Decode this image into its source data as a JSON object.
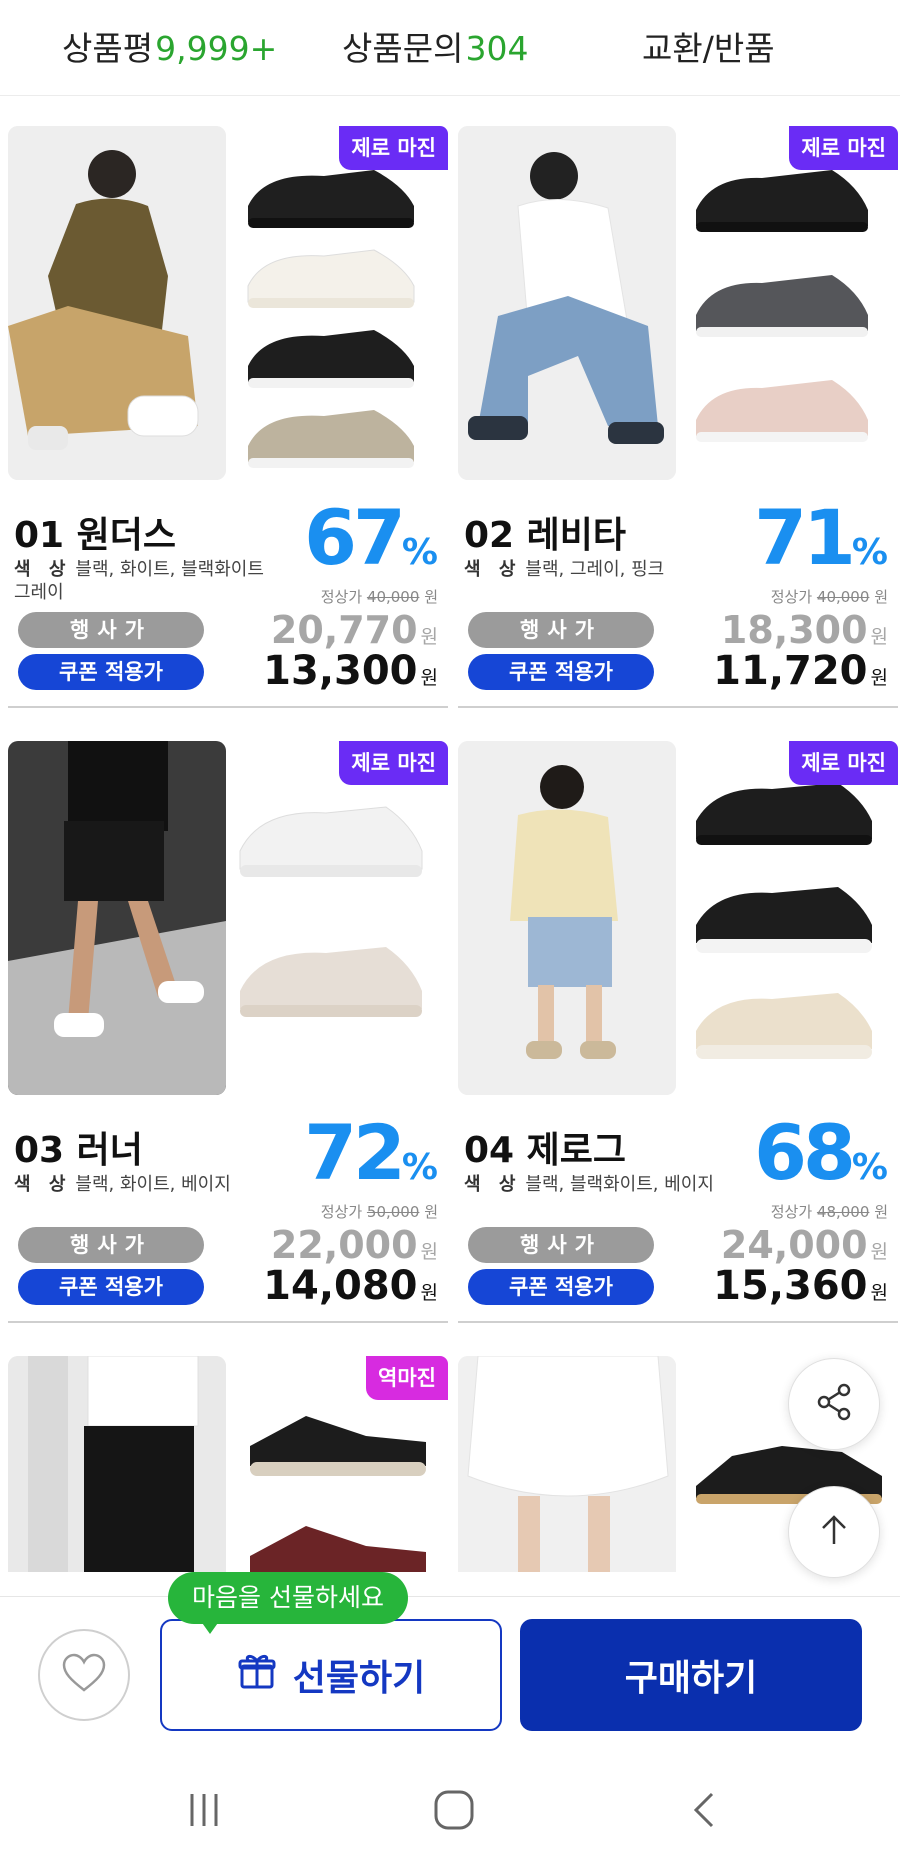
{
  "top_tabs": {
    "review_label": "상품평",
    "review_count": "9,999+",
    "qna_label": "상품문의",
    "qna_count": "304",
    "return_label": "교환/반품"
  },
  "products": [
    {
      "title": "01 원더스",
      "color_label": "색 상",
      "colors": "블랙, 화이트, 블랙화이트 그레이",
      "badge": "제로 마진",
      "discount": "67",
      "pct": "%",
      "regular_label": "정상가",
      "regular_price": "40,000",
      "won": "원",
      "event_label": "행사가",
      "event_price": "20,770",
      "coupon_label": "쿠폰 적용가",
      "coupon_price": "13,300"
    },
    {
      "title": "02 레비타",
      "color_label": "색 상",
      "colors": "블랙, 그레이, 핑크",
      "badge": "제로 마진",
      "discount": "71",
      "pct": "%",
      "regular_label": "정상가",
      "regular_price": "40,000",
      "won": "원",
      "event_label": "행사가",
      "event_price": "18,300",
      "coupon_label": "쿠폰 적용가",
      "coupon_price": "11,720"
    },
    {
      "title": "03 러너",
      "color_label": "색 상",
      "colors": "블랙, 화이트, 베이지",
      "badge": "제로 마진",
      "discount": "72",
      "pct": "%",
      "regular_label": "정상가",
      "regular_price": "50,000",
      "won": "원",
      "event_label": "행사가",
      "event_price": "22,000",
      "coupon_label": "쿠폰 적용가",
      "coupon_price": "14,080"
    },
    {
      "title": "04 제로그",
      "color_label": "색 상",
      "colors": "블랙, 블랙화이트, 베이지",
      "badge": "제로 마진",
      "discount": "68",
      "pct": "%",
      "regular_label": "정상가",
      "regular_price": "48,000",
      "won": "원",
      "event_label": "행사가",
      "event_price": "24,000",
      "coupon_label": "쿠폰 적용가",
      "coupon_price": "15,360"
    },
    {
      "badge": "역마진"
    }
  ],
  "bottom_bar": {
    "tooltip": "마음을 선물하세요",
    "gift_label": "선물하기",
    "buy_label": "구매하기"
  },
  "icons": {
    "heart": "heart-icon",
    "gift": "gift-icon",
    "share": "share-icon",
    "scroll_top": "arrow-up-icon",
    "recent_apps": "recent-apps-icon",
    "home": "home-icon",
    "back": "back-icon"
  },
  "colors": {
    "accent_green": "#2aa52f",
    "badge_purple": "#6a2cf5",
    "badge_pink": "#d72be0",
    "discount_blue": "#1a8ff0",
    "coupon_blue": "#1646d6",
    "buy_blue": "#0a2fae"
  }
}
